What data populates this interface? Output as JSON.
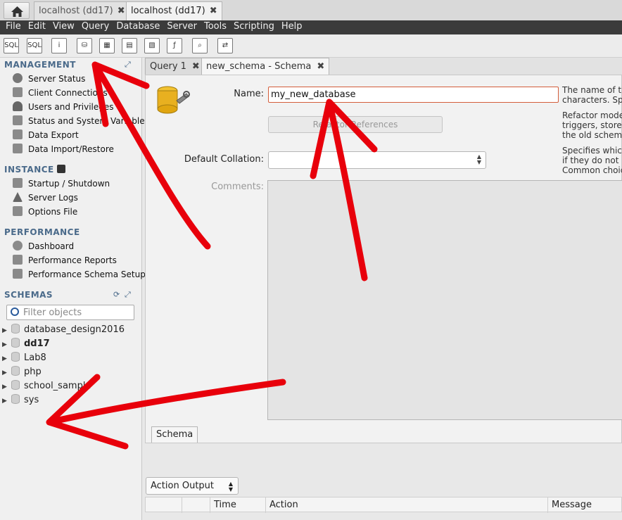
{
  "connection_tabs": [
    {
      "label": "localhost (dd17)",
      "active": false
    },
    {
      "label": "localhost (dd17)",
      "active": true
    }
  ],
  "menu": [
    "File",
    "Edit",
    "View",
    "Query",
    "Database",
    "Server",
    "Tools",
    "Scripting",
    "Help"
  ],
  "toolbar_icons": [
    {
      "name": "new-sql-tab-icon",
      "glyph": "SQL"
    },
    {
      "name": "open-sql-script-icon",
      "glyph": "SQL"
    },
    {
      "name": "inspector-icon",
      "glyph": "i"
    },
    {
      "name": "create-schema-icon",
      "glyph": "⛁"
    },
    {
      "name": "create-table-icon",
      "glyph": "▦"
    },
    {
      "name": "create-view-icon",
      "glyph": "▤"
    },
    {
      "name": "create-procedure-icon",
      "glyph": "▧"
    },
    {
      "name": "create-function-icon",
      "glyph": "ƒ"
    },
    {
      "name": "search-table-data-icon",
      "glyph": "⌕"
    },
    {
      "name": "reconnect-icon",
      "glyph": "⇄"
    }
  ],
  "sidebar": {
    "management": {
      "title": "MANAGEMENT",
      "items": [
        "Server Status",
        "Client Connections",
        "Users and Privileges",
        "Status and System Variables",
        "Data Export",
        "Data Import/Restore"
      ]
    },
    "instance": {
      "title": "INSTANCE",
      "items": [
        "Startup / Shutdown",
        "Server Logs",
        "Options File"
      ]
    },
    "performance": {
      "title": "PERFORMANCE",
      "items": [
        "Dashboard",
        "Performance Reports",
        "Performance Schema Setup"
      ]
    },
    "schemas": {
      "title": "SCHEMAS",
      "filter_placeholder": "Filter objects",
      "items": [
        {
          "label": "database_design2016",
          "bold": false
        },
        {
          "label": "dd17",
          "bold": true
        },
        {
          "label": "Lab8",
          "bold": false
        },
        {
          "label": "php",
          "bold": false
        },
        {
          "label": "school_sample",
          "bold": false
        },
        {
          "label": "sys",
          "bold": false
        }
      ]
    }
  },
  "editor_tabs": [
    {
      "label": "Query 1",
      "active": false
    },
    {
      "label": "new_schema - Schema",
      "active": true
    }
  ],
  "schema_editor": {
    "name_label": "Name:",
    "name_value": "my_new_database",
    "refactor_button": "Refactor References",
    "collation_label": "Default Collation:",
    "collation_value": "",
    "comments_label": "Comments:",
    "help_name": [
      "The name of th",
      "characters. Sp"
    ],
    "help_refactor": [
      "Refactor mode",
      "triggers, store",
      "the old schem"
    ],
    "help_collation": [
      "Specifies whic",
      "if they do not",
      "Common choic"
    ],
    "bottom_tab": "Schema"
  },
  "output": {
    "selector_value": "Action Output",
    "columns": [
      "Time",
      "Action",
      "Message"
    ]
  },
  "colors": {
    "menubar": "#3b3b3b",
    "section_title": "#4a6a8a",
    "annotation": "#e8000b"
  }
}
